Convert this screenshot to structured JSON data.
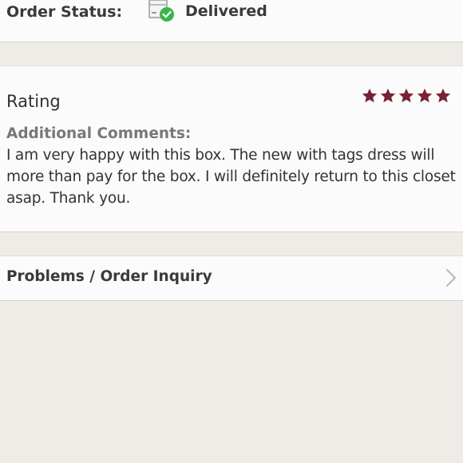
{
  "order_status": {
    "label": "Order Status:",
    "value": "Delivered",
    "icon": "delivered-box-check-icon",
    "icon_check_color": "#3bb54a"
  },
  "rating": {
    "title": "Rating",
    "stars": 5,
    "max_stars": 5,
    "star_color": "#7a2233",
    "comments_label": "Additional Comments:",
    "comments_text": "I am very happy with this box. The new with tags dress will more than pay for the box. I will definitely return to this closet asap. Thank you."
  },
  "problems": {
    "label": "Problems / Order Inquiry",
    "icon": "chevron-right-icon"
  }
}
